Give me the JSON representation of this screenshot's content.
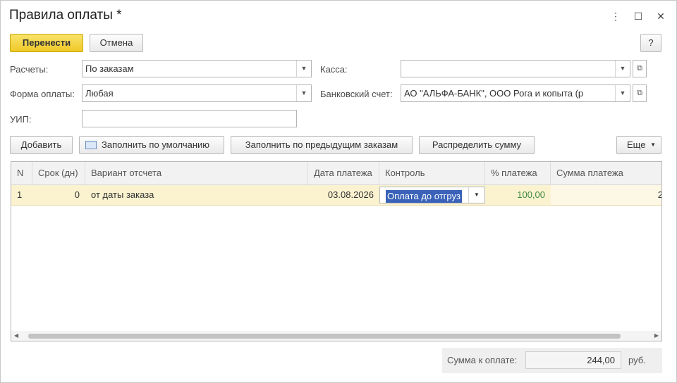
{
  "window": {
    "title": "Правила оплаты *",
    "more_icon": "⋮",
    "maximize_icon": "☐",
    "close_icon": "✕"
  },
  "toolbar": {
    "move_label": "Перенести",
    "cancel_label": "Отмена",
    "help_label": "?"
  },
  "form": {
    "calc_label": "Расчеты:",
    "calc_value": "По заказам",
    "payform_label": "Форма оплаты:",
    "payform_value": "Любая",
    "uip_label": "УИП:",
    "uip_value": "",
    "cashbox_label": "Касса:",
    "cashbox_value": "",
    "bank_label": "Банковский счет:",
    "bank_value": "АО \"АЛЬФА-БАНК\", ООО Рога и копыта (р"
  },
  "actions": {
    "add_label": "Добавить",
    "fill_default_label": "Заполнить по умолчанию",
    "fill_prev_label": "Заполнить по предыдущим заказам",
    "distribute_label": "Распределить сумму",
    "more_label": "Еще"
  },
  "table": {
    "columns": [
      "N",
      "Срок (дн)",
      "Вариант отсчета",
      "Дата платежа",
      "Контроль",
      "% платежа",
      "Сумма платежа"
    ],
    "rows": [
      {
        "n": "1",
        "term": "0",
        "variant": "от даты заказа",
        "date": "03.08.2026",
        "control": "Оплата до отгруз",
        "percent": "100,00",
        "sum": "2"
      }
    ]
  },
  "footer": {
    "total_label": "Сумма к оплате:",
    "total_value": "244,00",
    "currency": "руб."
  },
  "colors": {
    "accent_yellow": "#f0c928",
    "row_highlight": "#fbf2cf",
    "selection": "#3a62b8",
    "percent_green": "#3d8a3d"
  }
}
